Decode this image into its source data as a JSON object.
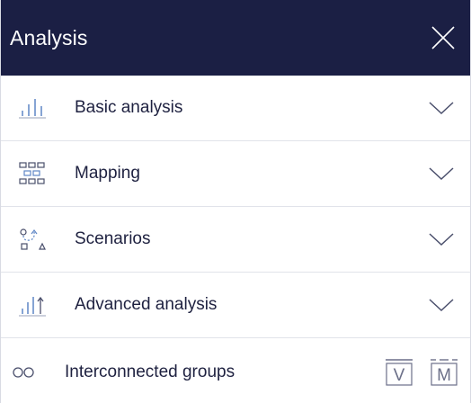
{
  "header": {
    "title": "Analysis",
    "close_icon": "close-icon",
    "background": "#1b1f44"
  },
  "sections": [
    {
      "label": "Basic analysis",
      "icon": "bar-chart-icon",
      "expand_icon": "chevron-down-icon"
    },
    {
      "label": "Mapping",
      "icon": "network-map-icon",
      "expand_icon": "chevron-down-icon"
    },
    {
      "label": "Scenarios",
      "icon": "scenario-path-icon",
      "expand_icon": "chevron-down-icon"
    },
    {
      "label": "Advanced analysis",
      "icon": "advanced-chart-icon",
      "expand_icon": "chevron-down-icon"
    }
  ],
  "interconnected": {
    "label": "Interconnected groups",
    "icon": "link-icon",
    "toggle_v": "V",
    "toggle_m": "M"
  }
}
